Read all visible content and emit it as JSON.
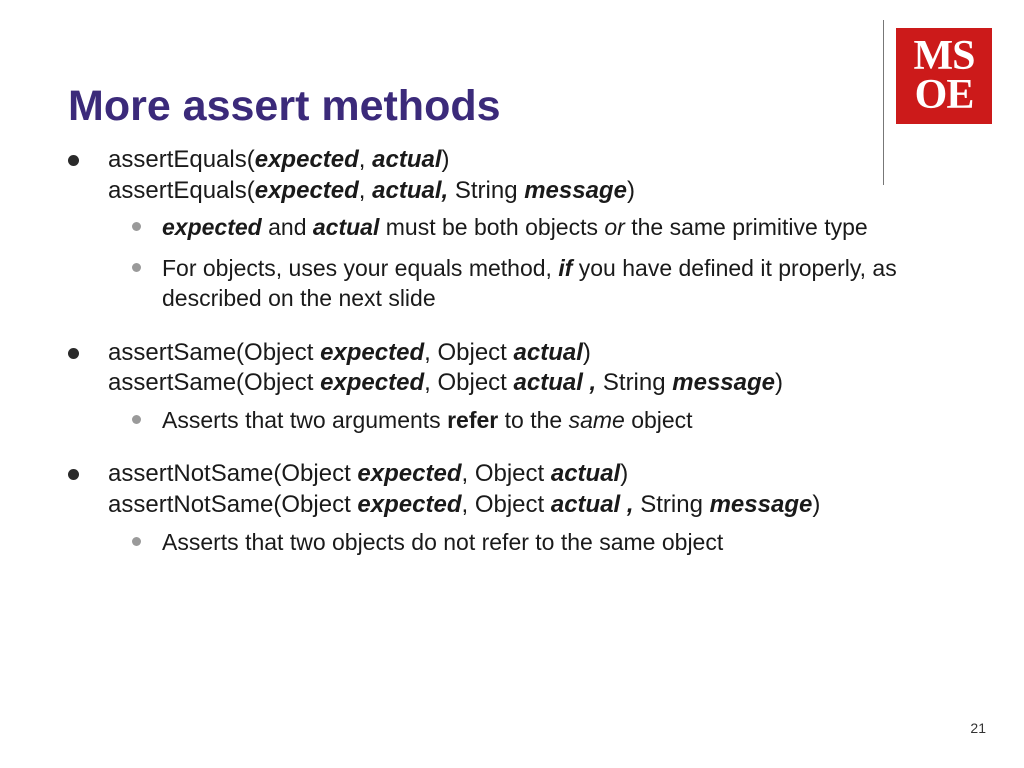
{
  "logo": {
    "line1": "MS",
    "line2": "OE"
  },
  "title": "More assert methods",
  "bullets": [
    {
      "lines": [
        [
          {
            "t": "assertEquals("
          },
          {
            "t": "expected",
            "cls": "bi"
          },
          {
            "t": ", "
          },
          {
            "t": "actual",
            "cls": "bi"
          },
          {
            "t": ")"
          }
        ],
        [
          {
            "t": "assertEquals("
          },
          {
            "t": "expected",
            "cls": "bi"
          },
          {
            "t": ", "
          },
          {
            "t": "actual,",
            "cls": "bi"
          },
          {
            "t": " String "
          },
          {
            "t": "message",
            "cls": "bi"
          },
          {
            "t": ")"
          }
        ]
      ],
      "sub": [
        [
          {
            "t": "expected",
            "cls": "bi"
          },
          {
            "t": " and "
          },
          {
            "t": "actual",
            "cls": "bi"
          },
          {
            "t": " must be both objects "
          },
          {
            "t": "or",
            "cls": "i"
          },
          {
            "t": " the same primitive type"
          }
        ],
        [
          {
            "t": "For objects, uses your equals method, "
          },
          {
            "t": "if",
            "cls": "bi"
          },
          {
            "t": " you have defined it properly, as described on the next slide"
          }
        ]
      ]
    },
    {
      "lines": [
        [
          {
            "t": "assertSame(Object "
          },
          {
            "t": "expected",
            "cls": "bi"
          },
          {
            "t": ", Object "
          },
          {
            "t": "actual",
            "cls": "bi"
          },
          {
            "t": ")"
          }
        ],
        [
          {
            "t": "assertSame(Object "
          },
          {
            "t": "expected",
            "cls": "bi"
          },
          {
            "t": ", Object "
          },
          {
            "t": "actual ,",
            "cls": "bi"
          },
          {
            "t": " String "
          },
          {
            "t": "message",
            "cls": "bi"
          },
          {
            "t": ")"
          }
        ]
      ],
      "sub": [
        [
          {
            "t": "Asserts that two arguments "
          },
          {
            "t": "refer",
            "cls": "b"
          },
          {
            "t": " to the "
          },
          {
            "t": "same",
            "cls": "i"
          },
          {
            "t": " object"
          }
        ]
      ]
    },
    {
      "lines": [
        [
          {
            "t": "assertNotSame(Object "
          },
          {
            "t": "expected",
            "cls": "bi"
          },
          {
            "t": ", Object "
          },
          {
            "t": "actual",
            "cls": "bi"
          },
          {
            "t": ")"
          }
        ],
        [
          {
            "t": "assertNotSame(Object "
          },
          {
            "t": "expected",
            "cls": "bi"
          },
          {
            "t": ", Object "
          },
          {
            "t": "actual ,",
            "cls": "bi"
          },
          {
            "t": " String "
          },
          {
            "t": "message",
            "cls": "bi"
          },
          {
            "t": ")"
          }
        ]
      ],
      "sub": [
        [
          {
            "t": "Asserts that two objects do not refer to the same object"
          }
        ]
      ]
    }
  ],
  "pageNumber": "21"
}
